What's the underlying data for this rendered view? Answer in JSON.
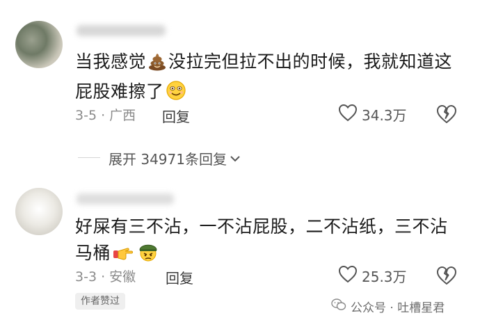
{
  "comments": [
    {
      "text_part1": "当我感觉",
      "text_part2": "没拉完但拉不出的时候，我就知道这屁股难擦了",
      "emoji_1": "poop-emoji",
      "emoji_2": "smile-emoji",
      "date_location": "3-5 · 广西",
      "reply_label": "回复",
      "likes": "34.3万"
    },
    {
      "text": "好屎有三不沾，一不沾屁股，二不沾纸，三不沾马桶",
      "emoji_1": "pointing-hand-emoji",
      "emoji_2": "soldier-emoji",
      "date_location": "3-3 · 安徽",
      "reply_label": "回复",
      "likes": "25.3万",
      "badge": "作者赞过"
    }
  ],
  "expand": {
    "label": "展开 34971条回复"
  },
  "watermark": {
    "text": "公众号 · 吐槽星君"
  },
  "colors": {
    "text": "#1a1a1a",
    "meta": "#8a8a8a",
    "background": "#ffffff"
  }
}
